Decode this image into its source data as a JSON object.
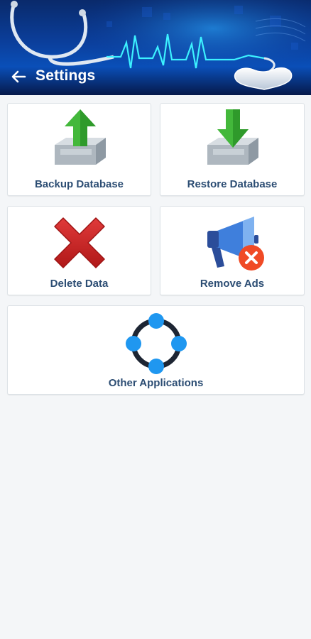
{
  "header": {
    "title": "Settings",
    "back_icon": "arrow-left-icon"
  },
  "colors": {
    "label_text": "#2c4d73",
    "header_bg": "#0b3f9c",
    "card_bg": "#ffffff",
    "page_bg": "#f4f6f8"
  },
  "cards": [
    {
      "label": "Backup Database",
      "icon": "upload-tray-icon"
    },
    {
      "label": "Restore Database",
      "icon": "download-tray-icon"
    },
    {
      "label": "Delete Data",
      "icon": "red-x-icon"
    },
    {
      "label": "Remove Ads",
      "icon": "megaphone-cancel-icon"
    },
    {
      "label": "Other Applications",
      "icon": "circle-nodes-icon"
    }
  ]
}
